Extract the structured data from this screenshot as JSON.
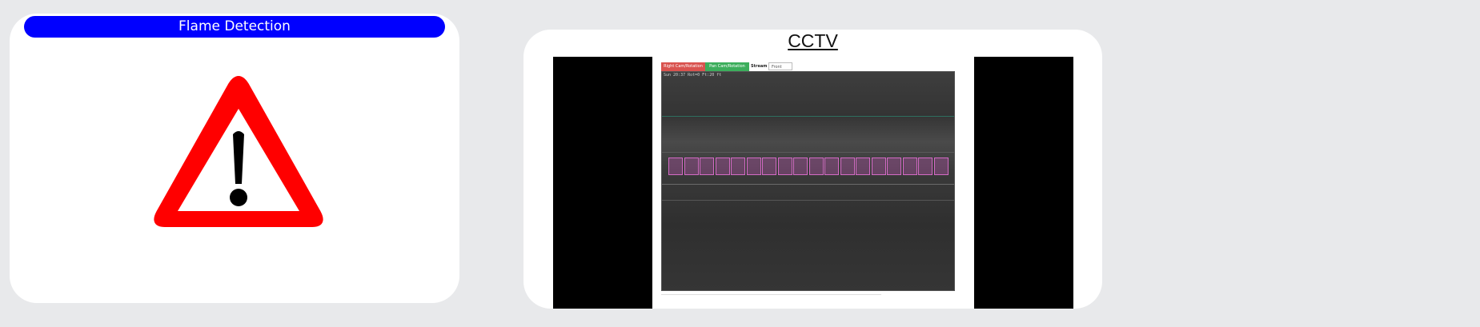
{
  "flame_panel": {
    "title": "Flame Detection",
    "icon": "warning-triangle-icon",
    "accent_color": "#0000ff",
    "warning_color": "#ff0000"
  },
  "cctv_panel": {
    "title": "CCTV",
    "stream": {
      "buttons": [
        "Right Cam/Rotation",
        "Pan Cam/Rotation"
      ],
      "stream_label": "Stream",
      "stream_select_value": "Front",
      "timestamp": "Sun 20:37 Rot=0 Ft:20 ft"
    }
  }
}
